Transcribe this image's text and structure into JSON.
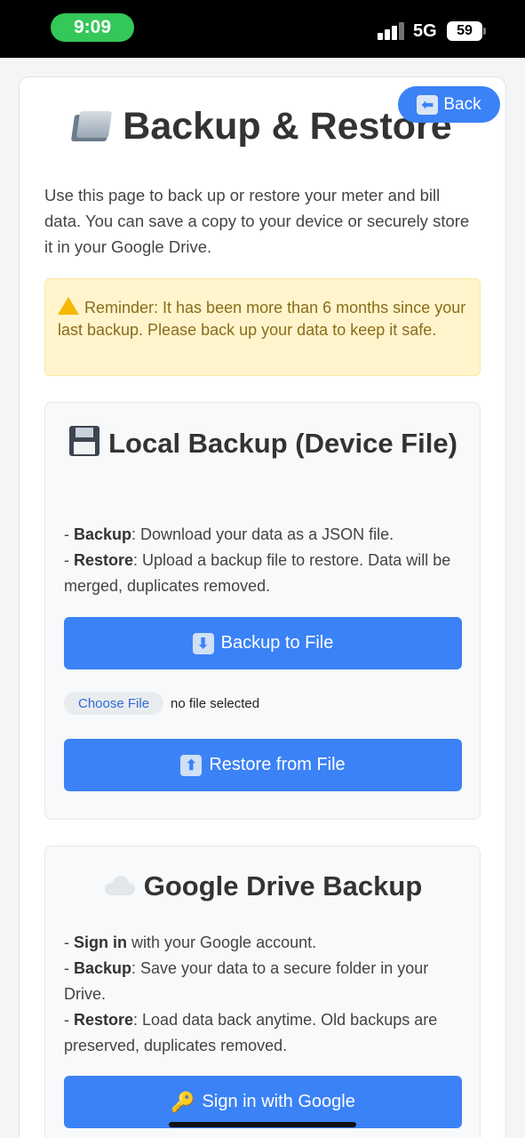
{
  "status_bar": {
    "time": "9:09",
    "network": "5G",
    "battery": "59"
  },
  "header": {
    "back_label": "Back",
    "title": "Backup & Restore"
  },
  "intro": "Use this page to back up or restore your meter and bill data. You can save a copy to your device or securely store it in your Google Drive.",
  "reminder": "Reminder: It has been more than 6 months since your last backup. Please back up your data to keep it safe.",
  "local": {
    "title": "Local Backup (Device File)",
    "items": [
      {
        "bold": "Backup",
        "text": ": Download your data as a JSON file."
      },
      {
        "bold": "Restore",
        "text": ": Upload a backup file to restore. Data will be merged, duplicates removed."
      }
    ],
    "backup_button": "Backup to File",
    "choose_file": "Choose File",
    "file_status": "no file selected",
    "restore_button": "Restore from File"
  },
  "google": {
    "title": "Google Drive Backup",
    "items": [
      {
        "bold": "Sign in",
        "text": " with your Google account."
      },
      {
        "bold": "Backup",
        "text": ": Save your data to a secure folder in your Drive."
      },
      {
        "bold": "Restore",
        "text": ": Load data back anytime. Old backups are preserved, duplicates removed."
      }
    ],
    "sign_in_button": "Sign in with Google"
  },
  "colors": {
    "accent": "#3b82f6",
    "warning_bg": "#fff4cc",
    "warning_text": "#8a6d1a",
    "status_pill": "#34c759"
  }
}
